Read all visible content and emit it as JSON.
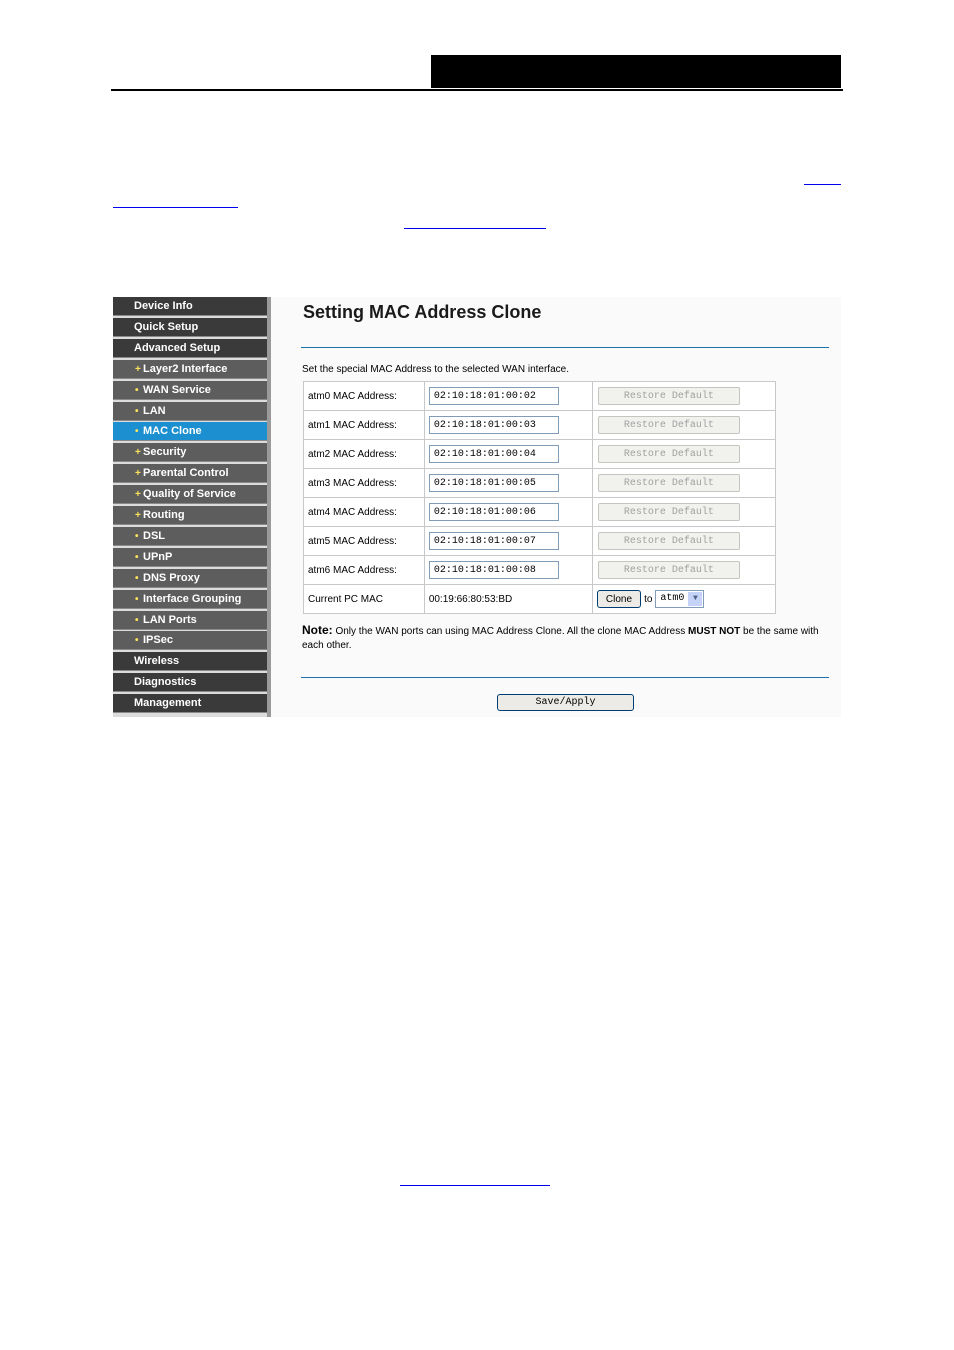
{
  "nav": {
    "items": [
      {
        "label": "Device Info",
        "level": "top",
        "active": false
      },
      {
        "label": "Quick Setup",
        "level": "top",
        "active": false
      },
      {
        "label": "Advanced Setup",
        "level": "top",
        "active": false
      },
      {
        "label": "Layer2 Interface",
        "level": "sub",
        "bullet": "+",
        "active": false
      },
      {
        "label": "WAN Service",
        "level": "sub",
        "bullet": "•",
        "active": false
      },
      {
        "label": "LAN",
        "level": "sub",
        "bullet": "•",
        "active": false
      },
      {
        "label": "MAC Clone",
        "level": "sub",
        "bullet": "•",
        "active": true
      },
      {
        "label": "Security",
        "level": "sub",
        "bullet": "+",
        "active": false
      },
      {
        "label": "Parental Control",
        "level": "sub",
        "bullet": "+",
        "active": false
      },
      {
        "label": "Quality of Service",
        "level": "sub",
        "bullet": "+",
        "active": false
      },
      {
        "label": "Routing",
        "level": "sub",
        "bullet": "+",
        "active": false
      },
      {
        "label": "DSL",
        "level": "sub",
        "bullet": "•",
        "active": false
      },
      {
        "label": "UPnP",
        "level": "sub",
        "bullet": "•",
        "active": false
      },
      {
        "label": "DNS Proxy",
        "level": "sub",
        "bullet": "•",
        "active": false
      },
      {
        "label": "Interface Grouping",
        "level": "sub",
        "bullet": "•",
        "active": false
      },
      {
        "label": "LAN Ports",
        "level": "sub",
        "bullet": "•",
        "active": false
      },
      {
        "label": "IPSec",
        "level": "sub",
        "bullet": "•",
        "active": false
      },
      {
        "label": "Wireless",
        "level": "top",
        "active": false
      },
      {
        "label": "Diagnostics",
        "level": "top",
        "active": false
      },
      {
        "label": "Management",
        "level": "top",
        "active": false
      }
    ]
  },
  "main": {
    "title": "Setting MAC Address Clone",
    "description": "Set the special MAC Address to the selected WAN interface.",
    "restore_label": "Restore Default",
    "rows": [
      {
        "label": "atm0 MAC Address:",
        "value": "02:10:18:01:00:02"
      },
      {
        "label": "atm1 MAC Address:",
        "value": "02:10:18:01:00:03"
      },
      {
        "label": "atm2 MAC Address:",
        "value": "02:10:18:01:00:04"
      },
      {
        "label": "atm3 MAC Address:",
        "value": "02:10:18:01:00:05"
      },
      {
        "label": "atm4 MAC Address:",
        "value": "02:10:18:01:00:06"
      },
      {
        "label": "atm5 MAC Address:",
        "value": "02:10:18:01:00:07"
      },
      {
        "label": "atm6 MAC Address:",
        "value": "02:10:18:01:00:08"
      }
    ],
    "current_pc": {
      "label": "Current PC MAC",
      "value": "00:19:66:80:53:BD",
      "clone_label": "Clone",
      "to_label": "to",
      "selected_wan": "atm0"
    },
    "note": {
      "label": "Note:",
      "text_before": " Only the WAN ports can using MAC Address Clone. All the clone MAC Address ",
      "emphasis": "MUST NOT",
      "text_after": " be the same with each other."
    },
    "save_label": "Save/Apply"
  },
  "colors": {
    "nav_active": "#1b8fcf",
    "nav_bg": "#3f3f3f",
    "rule": "#1d6fa8"
  }
}
